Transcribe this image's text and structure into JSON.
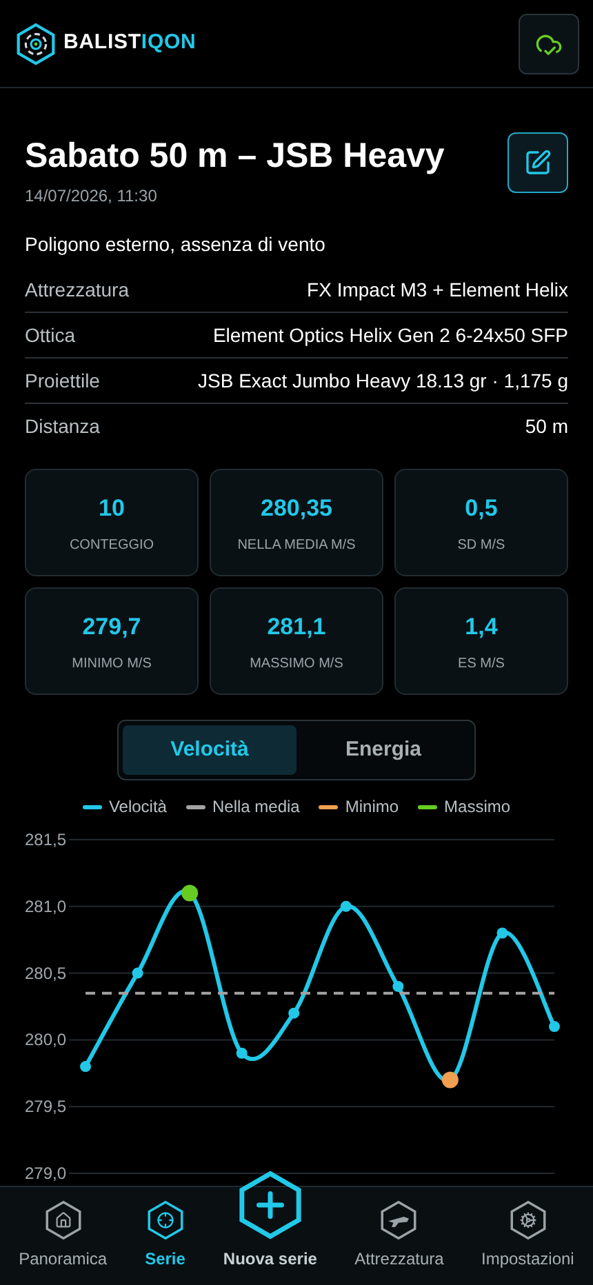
{
  "header": {
    "logo_text_a": "BALIST",
    "logo_text_b": "IQON",
    "synced": true
  },
  "session": {
    "title": "Sabato 50 m – JSB Heavy",
    "datetime": "14/07/2026, 11:30",
    "note": "Poligono esterno, assenza di vento"
  },
  "details": [
    {
      "label": "Attrezzatura",
      "value": "FX Impact M3 + Element Helix"
    },
    {
      "label": "Ottica",
      "value": "Element Optics Helix Gen 2 6-24x50 SFP"
    },
    {
      "label": "Proiettile",
      "value": "JSB Exact Jumbo Heavy 18.13 gr · 1,175 g"
    },
    {
      "label": "Distanza",
      "value": "50 m"
    }
  ],
  "stats": [
    {
      "value": "10",
      "label": "CONTEGGIO"
    },
    {
      "value": "280,35",
      "label": "NELLA MEDIA M/S"
    },
    {
      "value": "0,5",
      "label": "SD M/S"
    },
    {
      "value": "279,7",
      "label": "MINIMO M/S"
    },
    {
      "value": "281,1",
      "label": "MASSIMO M/S"
    },
    {
      "value": "1,4",
      "label": "ES M/S"
    }
  ],
  "chart_tabs": [
    {
      "label": "Velocità",
      "selected": true
    },
    {
      "label": "Energia",
      "selected": false
    }
  ],
  "chart_data": {
    "type": "line",
    "grid": true,
    "ylim": [
      279,
      281.5
    ],
    "yticks": [
      {
        "value": 279,
        "label": "279,0"
      },
      {
        "value": 279.5,
        "label": "279,5"
      },
      {
        "value": 280,
        "label": "280,0"
      },
      {
        "value": 280.5,
        "label": "280,5"
      },
      {
        "value": 281,
        "label": "281,0"
      },
      {
        "value": 281.5,
        "label": "281,5"
      }
    ],
    "series": [
      {
        "name": "Velocità",
        "color": "#22c8e8",
        "marker": "circle",
        "values": [
          279.8,
          280.5,
          281.1,
          279.9,
          280.2,
          281.0,
          280.4,
          279.7,
          280.8,
          280.1
        ]
      },
      {
        "name": "Nella media",
        "color": "#a3a3a3",
        "line_style": "dashed",
        "values": [
          280.35,
          280.35,
          280.35,
          280.35,
          280.35,
          280.35,
          280.35,
          280.35,
          280.35,
          280.35
        ]
      },
      {
        "name": "Minimo",
        "color": "#f0a050",
        "marker": "circle",
        "values": [
          null,
          null,
          null,
          null,
          null,
          null,
          null,
          279.7,
          null,
          null
        ]
      },
      {
        "name": "Massimo",
        "color": "#66cc22",
        "marker": "circle",
        "values": [
          null,
          null,
          281.1,
          null,
          null,
          null,
          null,
          null,
          null,
          null
        ]
      }
    ]
  },
  "nav": [
    {
      "label": "Panoramica",
      "kind": "home",
      "selected": false
    },
    {
      "label": "Serie",
      "kind": "target",
      "selected": true
    },
    {
      "label": "Nuova serie",
      "kind": "add",
      "selected": false
    },
    {
      "label": "Attrezzatura",
      "kind": "gear",
      "selected": false
    },
    {
      "label": "Impostazioni",
      "kind": "settings",
      "selected": false
    }
  ]
}
